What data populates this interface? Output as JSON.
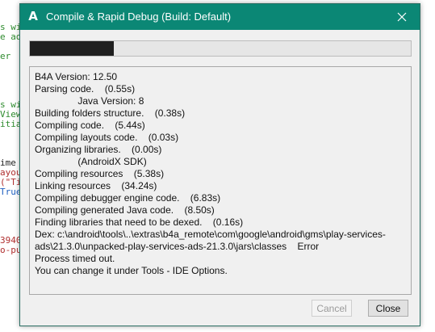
{
  "background_code": [
    {
      "text": "s wi",
      "color": "#2e8b2e"
    },
    {
      "text": "e ad",
      "color": "#2e8b2e"
    },
    {
      "text": "",
      "color": "#2e8b2e"
    },
    {
      "text": "er",
      "color": "#2e8b2e"
    },
    {
      "text": "",
      "color": "#2e8b2e"
    },
    {
      "text": "",
      "color": "#2e8b2e"
    },
    {
      "text": "",
      "color": "#2e8b2e"
    },
    {
      "text": "",
      "color": "#2e8b2e"
    },
    {
      "text": "s wi",
      "color": "#2e8b2e"
    },
    {
      "text": "View",
      "color": "#2e8b2e"
    },
    {
      "text": "itia",
      "color": "#2e8b2e"
    },
    {
      "text": "",
      "color": "#2e8b2e"
    },
    {
      "text": "",
      "color": "#2e8b2e"
    },
    {
      "text": "",
      "color": "#2e8b2e"
    },
    {
      "text": "ime",
      "color": "#222222"
    },
    {
      "text": "ayou",
      "color": "#b03030"
    },
    {
      "text": "(\"Ti",
      "color": "#b03030"
    },
    {
      "text": "True",
      "color": "#2060c0"
    },
    {
      "text": "",
      "color": "#2e8b2e"
    },
    {
      "text": "",
      "color": "#2e8b2e"
    },
    {
      "text": "",
      "color": "#2e8b2e"
    },
    {
      "text": "",
      "color": "#2e8b2e"
    },
    {
      "text": "3940",
      "color": "#b03030"
    },
    {
      "text": "o-pu",
      "color": "#b03030"
    }
  ],
  "dialog": {
    "app_icon": "A",
    "title": "Compile & Rapid Debug (Build: Default)",
    "close_icon": "close-icon",
    "progress_fraction": 0.22,
    "colors": {
      "titlebar": "#0b8775",
      "progress_fill": "#1f1f1f"
    },
    "log": [
      "B4A Version: 12.50",
      "Parsing code.    (0.55s)",
      "                Java Version: 8",
      "Building folders structure.    (0.38s)",
      "Compiling code.    (5.44s)",
      "Compiling layouts code.    (0.03s)",
      "Organizing libraries.    (0.00s)",
      "                (AndroidX SDK)",
      "Compiling resources    (5.38s)",
      "Linking resources    (34.24s)",
      "Compiling debugger engine code.    (6.83s)",
      "Compiling generated Java code.    (8.50s)",
      "Finding libraries that need to be dexed.    (0.16s)",
      "Dex: c:\\android\\tools\\..\\extras\\b4a_remote\\com\\google\\android\\gms\\play-services-ads\\21.3.0\\unpacked-play-services-ads-21.3.0\\jars\\classes    Error",
      "Process timed out.",
      "You can change it under Tools - IDE Options."
    ],
    "buttons": {
      "cancel": "Cancel",
      "close": "Close"
    }
  }
}
